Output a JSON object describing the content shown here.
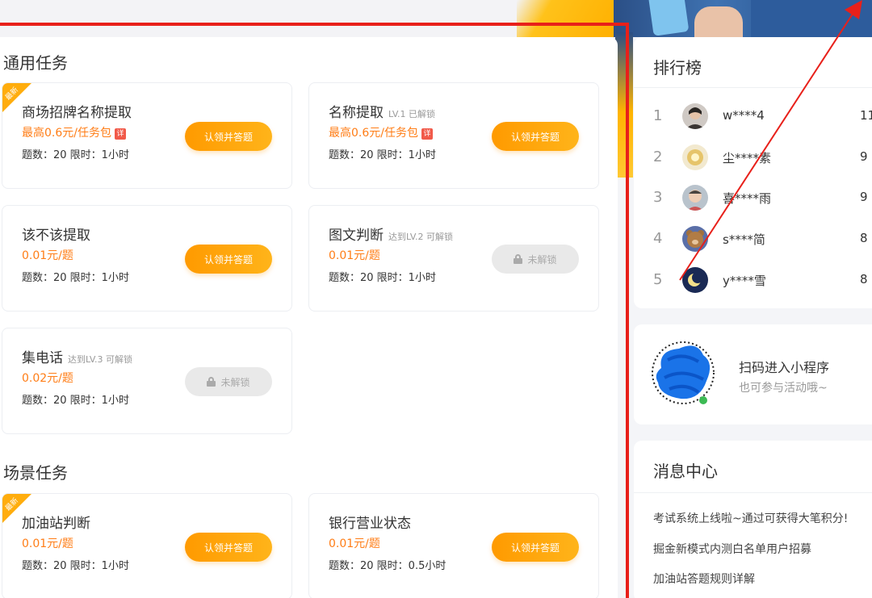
{
  "sections": {
    "general_title": "通用任务",
    "scene_title": "场景任务"
  },
  "new_badge": "最新",
  "tasks": [
    {
      "name": "商场招牌名称提取",
      "tag": "",
      "reward": "最高0.6元/任务包",
      "detail": "详",
      "meta": "题数：20 限时：1小时",
      "action": "认领并答题",
      "locked": false,
      "is_new": true
    },
    {
      "name": "名称提取",
      "tag": "LV.1 已解锁",
      "reward": "最高0.6元/任务包",
      "detail": "详",
      "meta": "题数：20 限时：1小时",
      "action": "认领并答题",
      "locked": false,
      "is_new": false
    },
    {
      "name": "该不该提取",
      "tag": "",
      "reward": "0.01元/题",
      "detail": "",
      "meta": "题数：20 限时：1小时",
      "action": "认领并答题",
      "locked": false,
      "is_new": false
    },
    {
      "name": "图文判断",
      "tag": "达到LV.2 可解锁",
      "reward": "0.01元/题",
      "detail": "",
      "meta": "题数：20 限时：1小时",
      "action": "未解锁",
      "locked": true,
      "is_new": false
    },
    {
      "name": "集电话",
      "tag": "达到LV.3 可解锁",
      "reward": "0.02元/题",
      "detail": "",
      "meta": "题数：20 限时：1小时",
      "action": "未解锁",
      "locked": true,
      "is_new": false
    },
    {
      "name": "加油站判断",
      "tag": "",
      "reward": "0.01元/题",
      "detail": "",
      "meta": "题数：20 限时：1小时",
      "action": "认领并答题",
      "locked": false,
      "is_new": true
    },
    {
      "name": "银行营业状态",
      "tag": "",
      "reward": "0.01元/题",
      "detail": "",
      "meta": "题数：20 限时：0.5小时",
      "action": "认领并答题",
      "locked": false,
      "is_new": false
    }
  ],
  "ranking": {
    "title": "排行榜",
    "rows": [
      {
        "rank": "1",
        "name": "w****4",
        "score": "11",
        "avatar": "person-avatar"
      },
      {
        "rank": "2",
        "name": "尘****素",
        "score": "9",
        "avatar": "gold-avatar"
      },
      {
        "rank": "3",
        "name": "喜****雨",
        "score": "9",
        "avatar": "child-avatar"
      },
      {
        "rank": "4",
        "name": "s****简",
        "score": "8",
        "avatar": "bear-avatar"
      },
      {
        "rank": "5",
        "name": "y****雪",
        "score": "8",
        "avatar": "moon-avatar"
      }
    ]
  },
  "mini_program": {
    "title": "扫码进入小程序",
    "subtitle": "也可参与活动哦~"
  },
  "messages": {
    "title": "消息中心",
    "items": [
      "考试系统上线啦~通过可获得大笔积分!",
      "掘金新模式内测白名单用户招募",
      "加油站答题规则详解"
    ]
  },
  "colors": {
    "accent": "#ff9a00",
    "reward_text": "#ff7d16",
    "annotation": "#e8201a"
  }
}
